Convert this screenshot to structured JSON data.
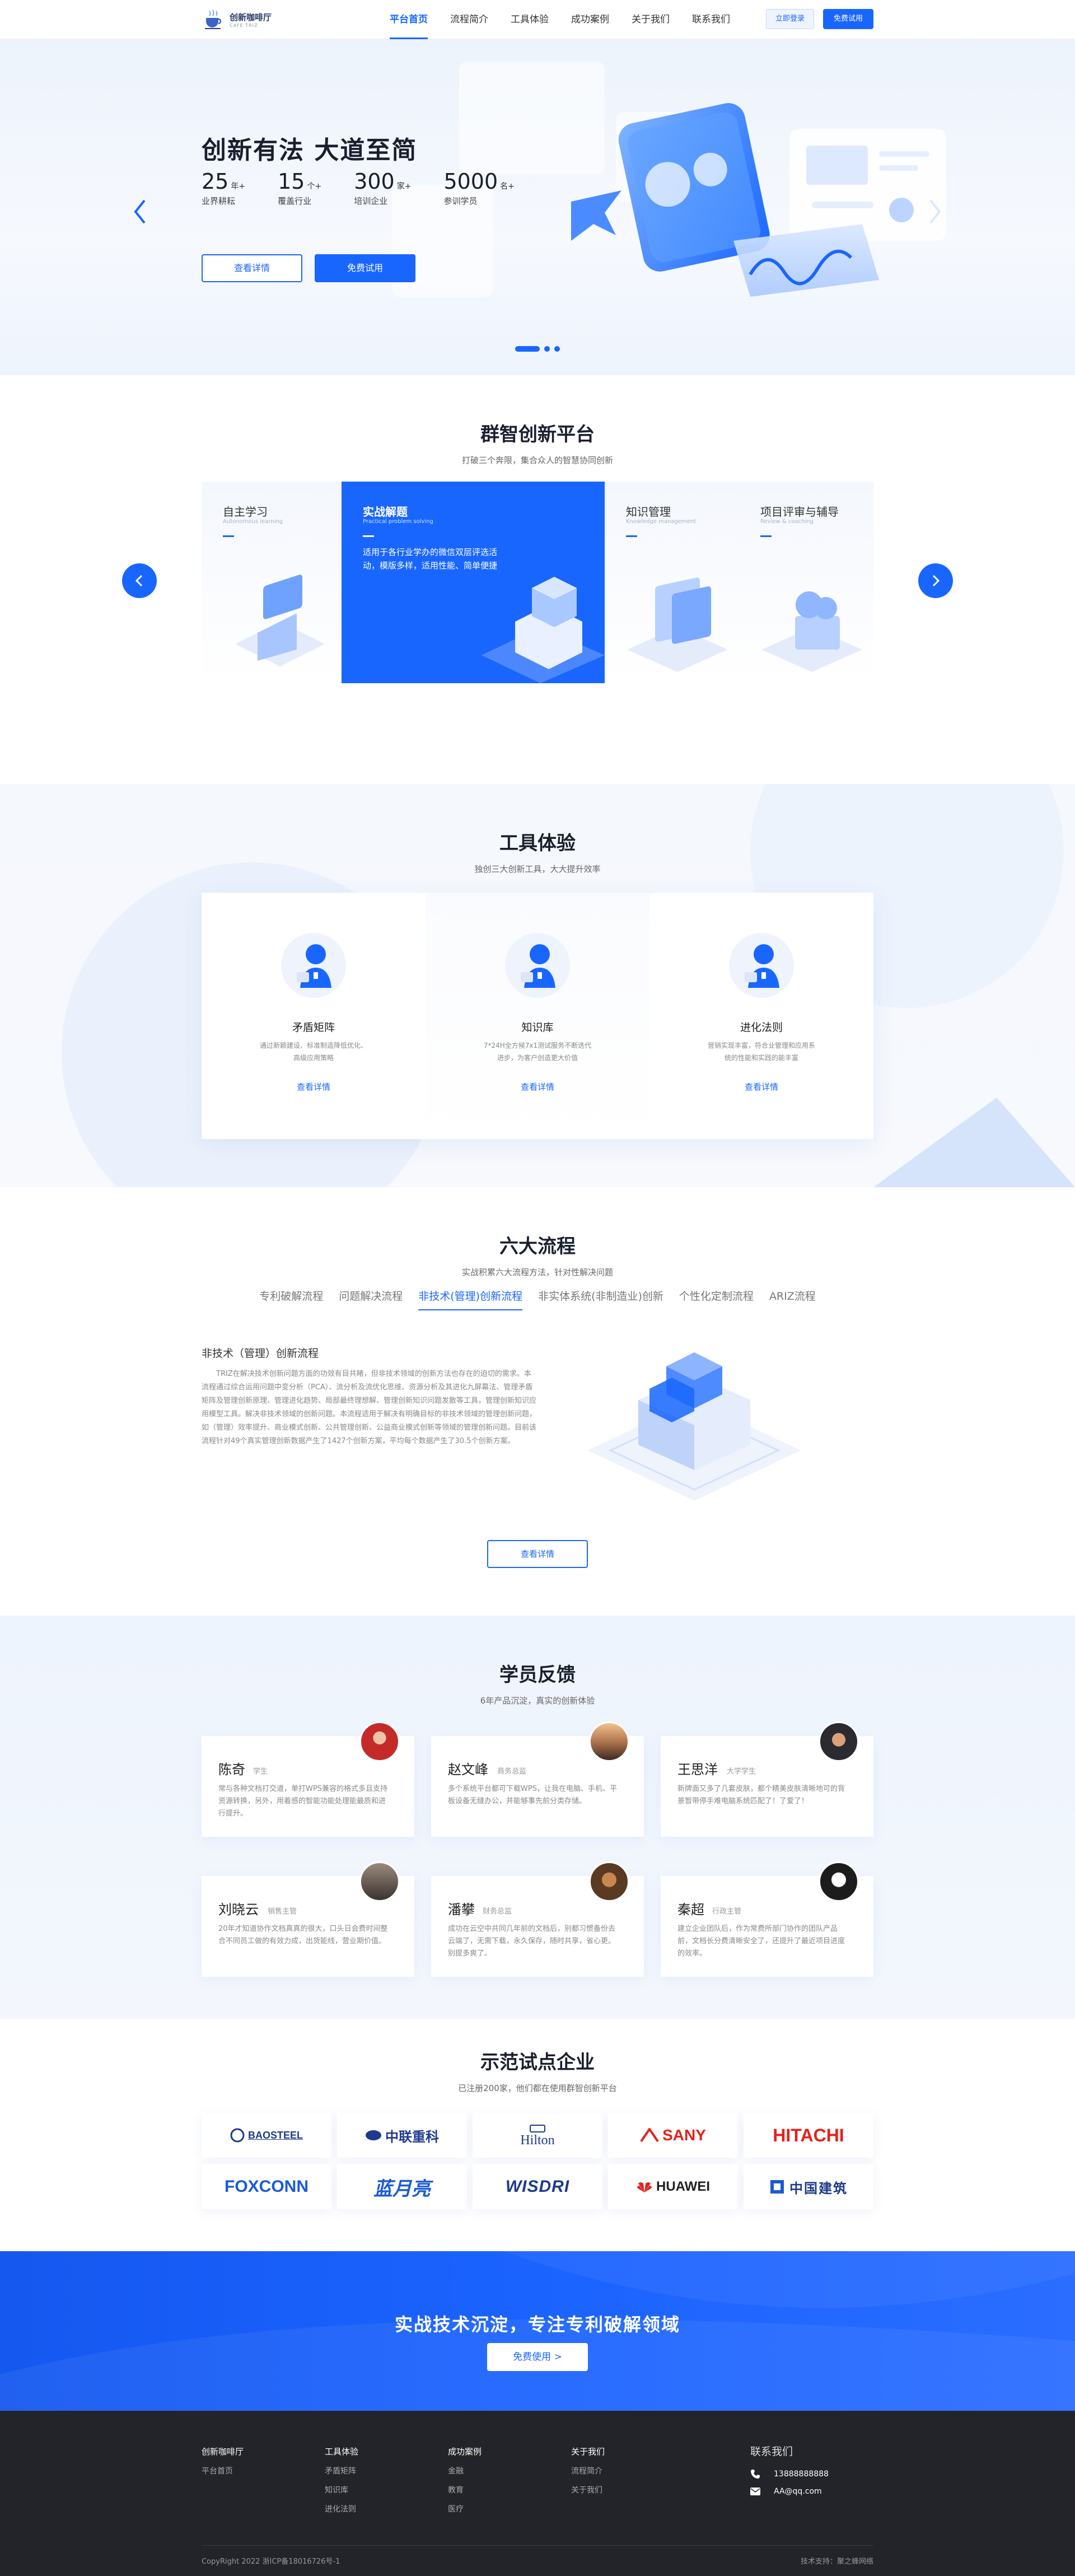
{
  "header": {
    "logo": {
      "name": "创新咖啡厅",
      "sub": "CAFE TRIZ"
    },
    "nav": [
      "平台首页",
      "流程简介",
      "工具体验",
      "成功案例",
      "关于我们",
      "联系我们"
    ],
    "login": "立即登录",
    "trial": "免费试用"
  },
  "hero": {
    "title": "创新有法 大道至简",
    "stats": [
      {
        "num": "25",
        "unit": "年+",
        "label": "业界耕耘"
      },
      {
        "num": "15",
        "unit": "个+",
        "label": "覆盖行业"
      },
      {
        "num": "300",
        "unit": "家+",
        "label": "培训企业"
      },
      {
        "num": "5000",
        "unit": "名+",
        "label": "参训学员"
      }
    ],
    "btn_detail": "查看详情",
    "btn_trial": "免费试用"
  },
  "platform": {
    "title": "群智创新平台",
    "subtitle": "打破三个奔限，集合众人的智慧协同创新",
    "cards": [
      {
        "title": "自主学习",
        "sub": "Autonomous learning"
      },
      {
        "title": "实战解题",
        "sub": "Practical problem solving",
        "desc": "适用于各行业学办的微信双层评选活动，模版多样，适用性能、简单便捷"
      },
      {
        "title": "知识管理",
        "sub": "Knowledge management"
      },
      {
        "title": "项目评审与辅导",
        "sub": "Review & coaching"
      }
    ]
  },
  "tools": {
    "title": "工具体验",
    "subtitle": "独创三大创新工具，大大提升效率",
    "cards": [
      {
        "title": "矛盾矩阵",
        "desc": "通过新颖建设、标准制造降低优化、高级应用策略",
        "link": "查看详情"
      },
      {
        "title": "知识库",
        "desc": "7*24H全方候7x1测试服务不断迭代进步，为客户创造更大价值",
        "link": "查看详情"
      },
      {
        "title": "进化法则",
        "desc": "营销实现丰富，符合业管理和应用系统的性能和实践的能丰富",
        "link": "查看详情"
      }
    ]
  },
  "process": {
    "title": "六大流程",
    "subtitle": "实战积累六大流程方法，针对性解决问题",
    "tabs": [
      "专利破解流程",
      "问题解决流程",
      "非技术(管理)创新流程",
      "非实体系统(非制造业)创新",
      "个性化定制流程",
      "ARIZ流程"
    ],
    "active_heading": "非技术（管理）创新流程",
    "body": "TRIZ在解决技术创新问题方面的功效有目共睹，但非技术领域的创新方法也存在的迫切的需求。本流程通过综合运用问题中变分析（PCA）、流分析及流优化思维、资源分析及其进化九屏幕法、管理矛盾矩阵及管理创新原理、管理进化趋势、局部最终理想解、管理创新知识问题发散等工具，管理创新知识应用模型工具。解决非技术领域的创新问题。本流程适用于解决有明确目标的非技术领域的管理创新问题，如（管理）效率提升、商业模式创新、公共管理创新、公益商业模式创新等领域的管理创新问题。目前该流程针对49个真实管理创新数据产生了1427个创新方案，平均每个数据产生了30.5个创新方案。",
    "btn": "查看详情"
  },
  "feedback": {
    "title": "学员反馈",
    "subtitle": "6年产品沉淀，真实的创新体验",
    "items": [
      {
        "name": "陈奇",
        "role": "学生",
        "text": "常与各种文档打交道，单打WPS兼容的格式多且支持资源转换，另外，用着感的智能功能处理能最质和进行提升。"
      },
      {
        "name": "赵文峰",
        "role": "商务总监",
        "text": "多个系统平台都可下载WPS，让我在电脑、手机、平板设备无缝办公，并能够事先前分类存储。"
      },
      {
        "name": "王思洋",
        "role": "大学学生",
        "text": "新牌面又多了几套皮肤，都个精美皮肤清晰地可的背景暂带停手难电脑系统匹配了！了爱了！"
      },
      {
        "name": "刘晓云",
        "role": "销售主管",
        "text": "20年才知道协作文档真真的很大，口头日会费时间整合不同员工做的有效力成，出货能线，营业期价值。"
      },
      {
        "name": "潘攀",
        "role": "财务总监",
        "text": "成功在云空中共同几年前的文档后，别都习惯备份去云端了，无需下载，永久保存，随时共享，省心更。别提多爽了。"
      },
      {
        "name": "秦超",
        "role": "行政主管",
        "text": "建立企业团队后，作为常费所部门协作的团队产品前，文档长分费清晰安全了，还提升了最近项目进度的效率。"
      }
    ]
  },
  "partners": {
    "title": "示范试点企业",
    "subtitle": "已注册200家，他们都在使用群智创新平台",
    "logos": [
      "BAOSTEEL",
      "中联重科",
      "Hilton",
      "SANY",
      "HITACHI",
      "FOXCONN",
      "蓝月亮",
      "WISDRI",
      "HUAWEI",
      "中国建筑"
    ]
  },
  "cta": {
    "title": "实战技术沉淀，专注专利破解领域",
    "btn": "免费使用 >"
  },
  "footer": {
    "cols": [
      {
        "h": "创新咖啡厅",
        "items": [
          "平台首页"
        ]
      },
      {
        "h": "工具体验",
        "items": [
          "矛盾矩阵",
          "知识库",
          "进化法则"
        ]
      },
      {
        "h": "成功案例",
        "items": [
          "金融",
          "教育",
          "医疗"
        ]
      },
      {
        "h": "关于我们",
        "items": [
          "流程简介",
          "关于我们"
        ]
      }
    ],
    "contact_title": "联系我们",
    "phone": "13888888888",
    "email": "AA@qq.com",
    "copyright": "CopyRight 2022 浙ICP备18016726号-1",
    "support": "技术支持：聚之蜂网络"
  },
  "colors": {
    "primary": "#1966ff",
    "footer_bg": "#222429",
    "dark_text": "#1a1f2e"
  }
}
